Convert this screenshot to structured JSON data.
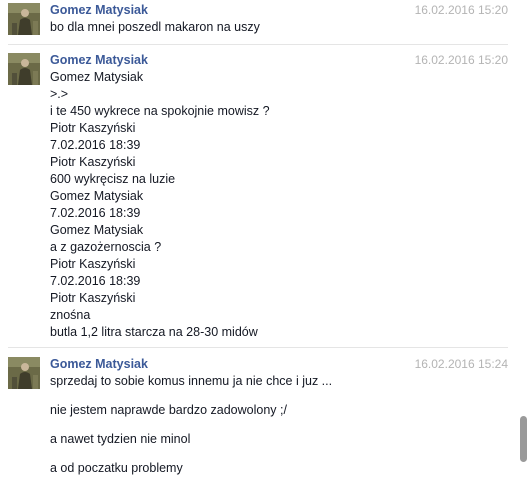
{
  "messages": [
    {
      "author": "Gomez Matysiak",
      "timestamp": "16.02.2016 15:20",
      "lines": [
        "bo dla mnei poszedl makaron na uszy"
      ]
    },
    {
      "author": "Gomez Matysiak",
      "timestamp": "16.02.2016 15:20",
      "lines": [
        "Gomez Matysiak",
        ">.>",
        "i te 450 wykrece na spokojnie mowisz ?",
        "Piotr Kaszyński",
        "7.02.2016 18:39",
        "Piotr Kaszyński",
        "600 wykręcisz na luzie",
        "Gomez Matysiak",
        "7.02.2016 18:39",
        "Gomez Matysiak",
        "a z gazożernoscia ?",
        "Piotr Kaszyński",
        "7.02.2016 18:39",
        "Piotr Kaszyński",
        "znośna",
        "butla 1,2 litra starcza na 28-30 midów"
      ]
    },
    {
      "author": "Gomez Matysiak",
      "timestamp": "16.02.2016 15:24",
      "lines": [
        "sprzedaj to sobie komus innemu ja nie chce i juz ...",
        "nie jestem naprawde bardzo zadowolony ;/",
        "a nawet tydzien nie minol",
        "a od poczatku problemy"
      ]
    }
  ],
  "avatar_icon": "user-avatar-photo",
  "colors": {
    "author_name": "#3b5998",
    "timestamp": "#b4b4b4",
    "message_text": "#141823",
    "scroll_thumb": "#9a9a9a"
  }
}
